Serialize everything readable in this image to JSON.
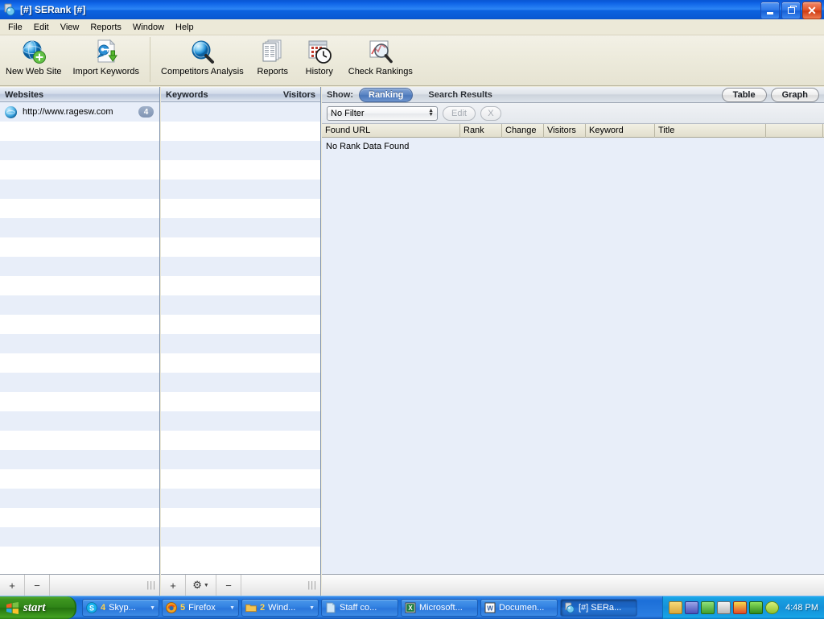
{
  "window": {
    "title": "[#] SERank [#]",
    "icon": "serank-app-icon",
    "minimize_label": "Minimize",
    "maximize_label": "Restore",
    "close_label": "Close"
  },
  "menubar": {
    "items": [
      {
        "label": "File"
      },
      {
        "label": "Edit"
      },
      {
        "label": "View"
      },
      {
        "label": "Reports"
      },
      {
        "label": "Window"
      },
      {
        "label": "Help"
      }
    ]
  },
  "toolbar": {
    "group1": [
      {
        "label": "New Web Site",
        "icon": "globe-plus-icon"
      },
      {
        "label": "Import Keywords",
        "icon": "document-key-download-icon"
      }
    ],
    "group2": [
      {
        "label": "Competitors Analysis",
        "icon": "globe-magnifier-icon"
      },
      {
        "label": "Reports",
        "icon": "stacked-documents-icon"
      },
      {
        "label": "History",
        "icon": "calendar-clock-icon"
      },
      {
        "label": "Check Rankings",
        "icon": "chart-magnifier-icon"
      }
    ]
  },
  "websites_panel": {
    "header": "Websites",
    "rows": [
      {
        "url": "http://www.ragesw.com",
        "badge": "4",
        "icon": "globe-icon"
      }
    ],
    "empty_row_count": 23
  },
  "keywords_panel": {
    "header_left": "Keywords",
    "header_right": "Visitors",
    "empty_row_count": 24
  },
  "main_panel": {
    "show_label": "Show:",
    "segments": [
      {
        "label": "Ranking",
        "selected": true
      },
      {
        "label": "Search Results",
        "selected": false
      }
    ],
    "view_buttons": [
      {
        "label": "Table"
      },
      {
        "label": "Graph"
      }
    ],
    "filter": {
      "value": "No Filter",
      "edit_label": "Edit",
      "clear_label": "X"
    },
    "columns": [
      {
        "label": "Found URL",
        "width": 172
      },
      {
        "label": "Rank",
        "width": 52
      },
      {
        "label": "Change",
        "width": 52
      },
      {
        "label": "Visitors",
        "width": 52
      },
      {
        "label": "Keyword",
        "width": 86
      },
      {
        "label": "Title",
        "width": 138
      },
      {
        "label": "",
        "width": 71
      }
    ],
    "empty_message": "No Rank Data Found"
  },
  "bottom_bars": {
    "websites": [
      {
        "label": "+",
        "name": "add-website-button"
      },
      {
        "label": "−",
        "name": "remove-website-button"
      },
      {
        "label": "|||",
        "name": "resize-grip"
      }
    ],
    "keywords": [
      {
        "label": "+",
        "name": "add-keyword-button"
      },
      {
        "label": "⚙",
        "name": "keyword-settings-button"
      },
      {
        "label": "−",
        "name": "remove-keyword-button"
      },
      {
        "label": "|||",
        "name": "resize-grip"
      }
    ]
  },
  "taskbar": {
    "start_label": "start",
    "tasks": [
      {
        "count": "4",
        "label": "Skyp...",
        "icon": "skype-icon",
        "has_arrow": true,
        "active": false
      },
      {
        "count": "5",
        "label": "Firefox",
        "icon": "firefox-icon",
        "has_arrow": true,
        "active": false
      },
      {
        "count": "2",
        "label": "Wind...",
        "icon": "folder-icon",
        "has_arrow": true,
        "active": false
      },
      {
        "count": "",
        "label": "Staff co...",
        "icon": "document-icon",
        "has_arrow": false,
        "active": false
      },
      {
        "count": "",
        "label": "Microsoft...",
        "icon": "excel-icon",
        "has_arrow": false,
        "active": false
      },
      {
        "count": "",
        "label": "Documen...",
        "icon": "word-icon",
        "has_arrow": false,
        "active": false
      },
      {
        "count": "",
        "label": "[#] SERa...",
        "icon": "serank-app-icon",
        "has_arrow": false,
        "active": true
      }
    ],
    "tray_icons": [
      "clipboard-icon",
      "network-icon",
      "security-lock-icon",
      "printer-icon",
      "shield-alert-icon",
      "update-icon",
      "antivirus-icon"
    ],
    "clock": "4:48 PM"
  },
  "colors": {
    "titlebar_blue": "#1066e8",
    "selected_segment": "#5c86c4",
    "panel_row_alt": "#e8eef9",
    "badge": "#8094b3",
    "taskbar_blue": "#2a7ce0",
    "start_green": "#3e9620",
    "tray_blue": "#18a0e2"
  }
}
